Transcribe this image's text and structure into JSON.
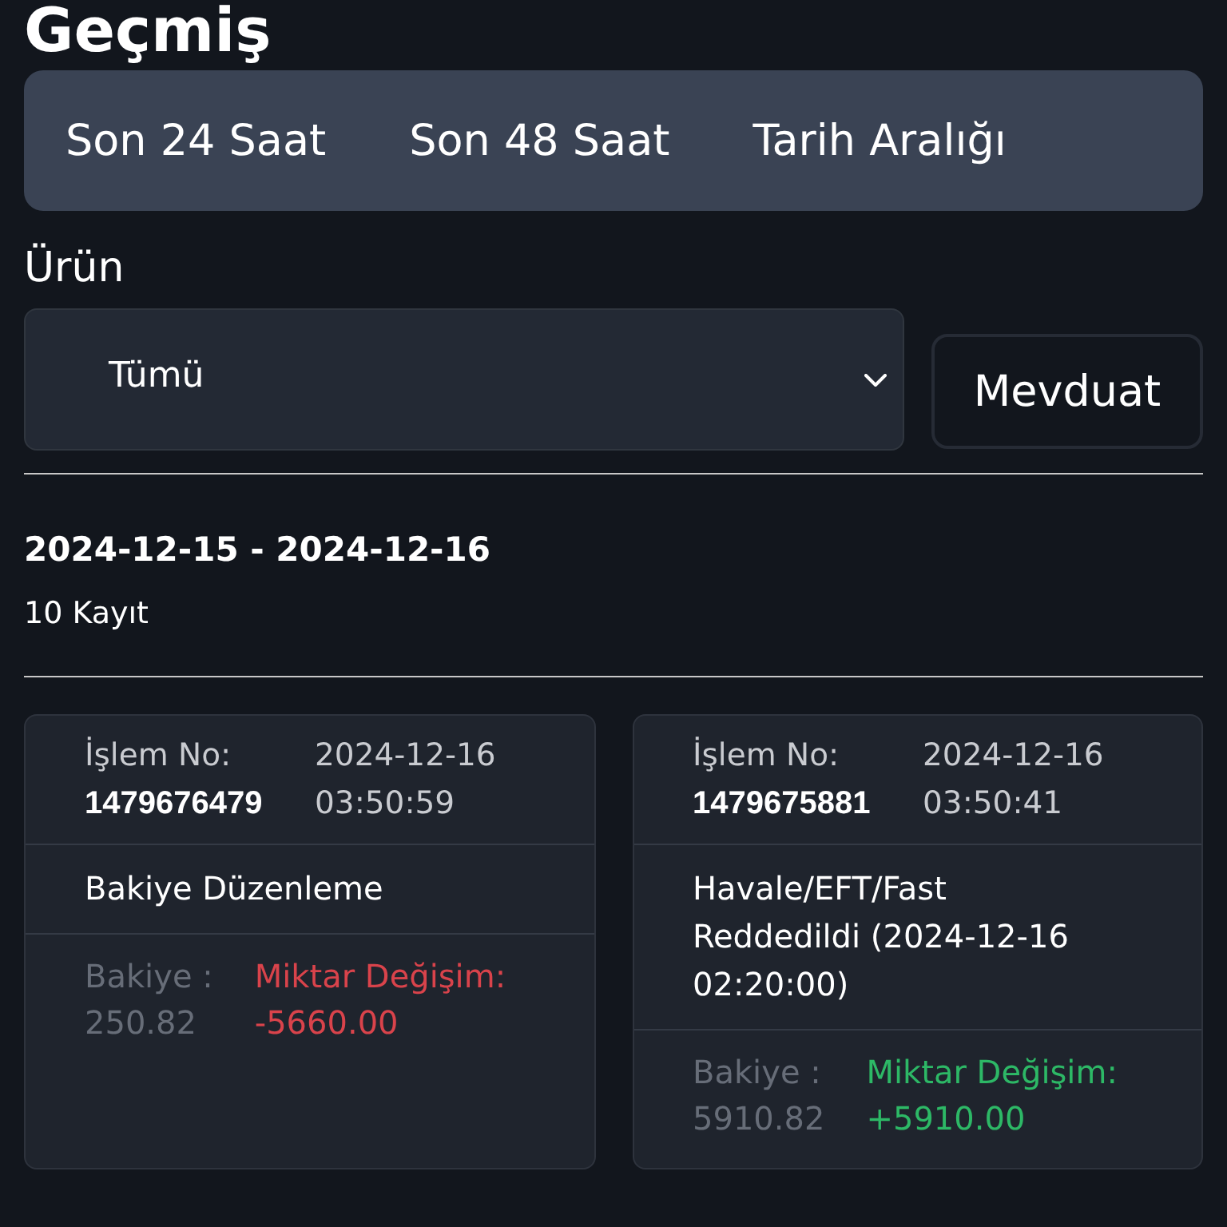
{
  "page": {
    "title": "Geçmiş"
  },
  "tabs": [
    {
      "label": "Son 24 Saat",
      "selected": false
    },
    {
      "label": "Son 48 Saat",
      "selected": false
    },
    {
      "label": "Tarih Aralığı",
      "selected": false
    }
  ],
  "filter": {
    "label": "Ürün",
    "select_value": "Tümü",
    "button": "Mevduat"
  },
  "summary": {
    "range": "2024-12-15 - 2024-12-16",
    "count": "10 Kayıt"
  },
  "transactions": [
    {
      "id_label": "İşlem No:",
      "id": "1479676479",
      "date": "2024-12-16",
      "time": "03:50:59",
      "description": "Bakiye Düzenleme",
      "balance_label": "Bakiye :",
      "balance": "250.82",
      "change_label": "Miktar Değişim:",
      "change": "-5660.00",
      "color": "#d9434b"
    },
    {
      "id_label": "İşlem No:",
      "id": "1479675881",
      "date": "2024-12-16",
      "time": "03:50:41",
      "description": "Havale/EFT/Fast Reddedildi (2024-12-16 02:20:00)",
      "balance_label": "Bakiye :",
      "balance": "5910.82",
      "change_label": "Miktar Değişim:",
      "change": "+5910.00",
      "color": "#2db866"
    }
  ]
}
